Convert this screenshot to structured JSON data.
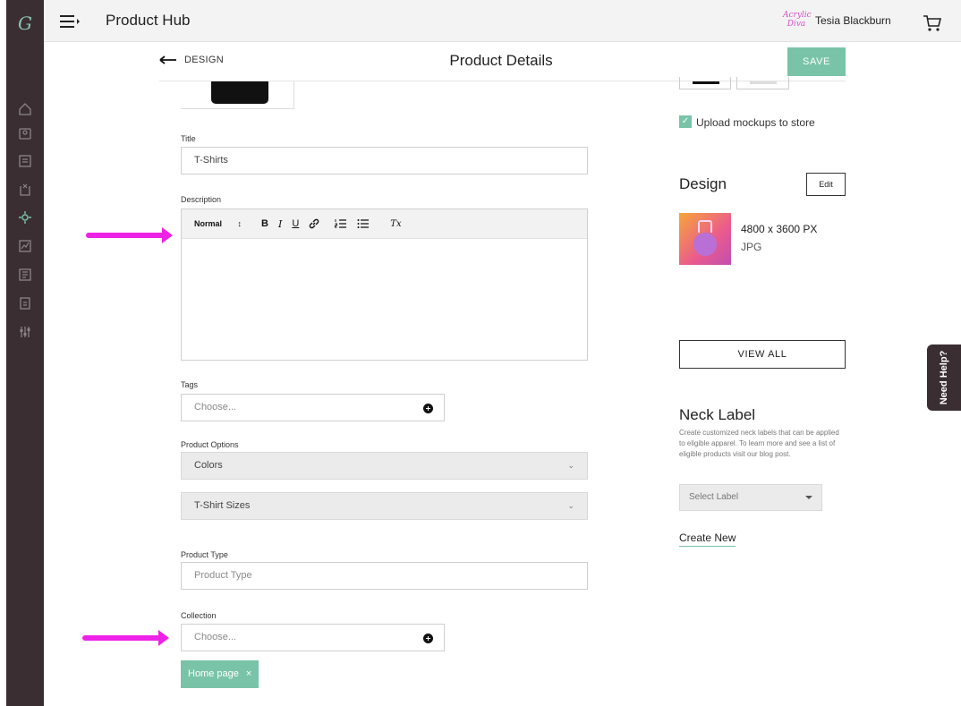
{
  "app": {
    "logo": "G",
    "title": "Product Hub"
  },
  "user": {
    "brand_logo_line1": "Acrylic",
    "brand_logo_line2": "Diva",
    "name": "Tesia Blackburn"
  },
  "header": {
    "back_label": "DESIGN",
    "page_title": "Product Details",
    "save_label": "SAVE"
  },
  "sidebar": {
    "icons": [
      "home-icon",
      "products-icon",
      "orders-icon",
      "import-icon",
      "integrations-icon",
      "analytics-icon",
      "catalog-icon",
      "billing-icon",
      "settings-icon"
    ]
  },
  "form": {
    "title_label": "Title",
    "title_value": "T-Shirts",
    "description_label": "Description",
    "editor_format": "Normal",
    "editor_format_arrows": "↕",
    "editor_buttons": {
      "bold": "B",
      "italic": "I",
      "underline": "U",
      "link": "🔗",
      "ordered_list": "☰",
      "bullet_list": "≡",
      "clear": "Tx"
    },
    "tags_label": "Tags",
    "tags_placeholder": "Choose...",
    "product_options_label": "Product Options",
    "options": [
      "Colors",
      "T-Shirt Sizes"
    ],
    "product_type_label": "Product Type",
    "product_type_placeholder": "Product Type",
    "collection_label": "Collection",
    "collection_placeholder": "Choose...",
    "collection_chip": "Home page",
    "chip_remove": "×"
  },
  "mockups": {
    "upload_label": "Upload mockups to store",
    "checked": true
  },
  "design": {
    "heading": "Design",
    "edit_label": "Edit",
    "dimensions": "4800 x 3600 PX",
    "format": "JPG",
    "view_all_label": "VIEW ALL"
  },
  "neck_label": {
    "heading": "Neck Label",
    "description": "Create customized neck labels that can be applied to eligible apparel. To learn more and see a list of eligible products visit our blog post.",
    "select_placeholder": "Select Label",
    "create_new_label": "Create New"
  },
  "help": {
    "label": "Need Help?"
  },
  "colors": {
    "accent": "#79c4a8",
    "sidebar": "#3a2e32",
    "annotation": "#ee22e6"
  }
}
